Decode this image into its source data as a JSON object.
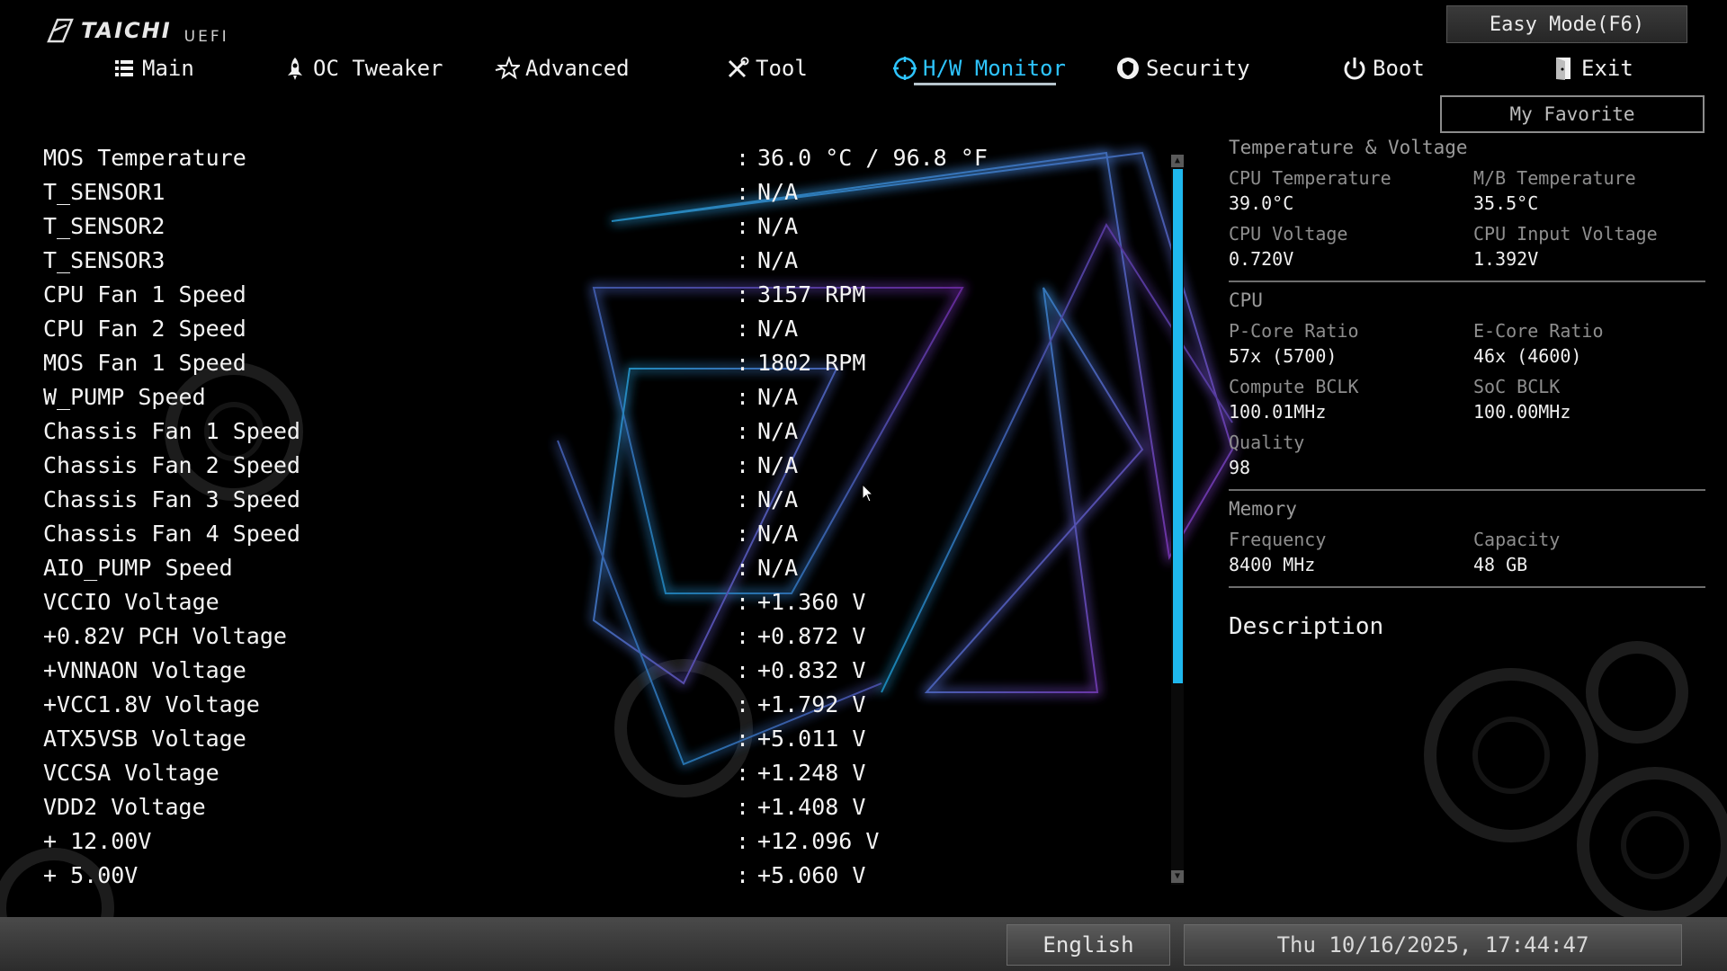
{
  "brand": {
    "name": "TAICHI",
    "sub": "UEFI"
  },
  "easy_mode_label": "Easy Mode(F6)",
  "my_favorite_label": "My Favorite",
  "nav": [
    {
      "label": "Main",
      "icon": "list-icon"
    },
    {
      "label": "OC Tweaker",
      "icon": "rocket-icon"
    },
    {
      "label": "Advanced",
      "icon": "star-icon"
    },
    {
      "label": "Tool",
      "icon": "tools-icon"
    },
    {
      "label": "H/W Monitor",
      "icon": "monitor-icon",
      "active": true
    },
    {
      "label": "Security",
      "icon": "shield-icon"
    },
    {
      "label": "Boot",
      "icon": "power-icon"
    },
    {
      "label": "Exit",
      "icon": "exit-icon"
    }
  ],
  "rows": [
    {
      "label": "MOS Temperature",
      "value": "36.0 °C /  96.8 °F"
    },
    {
      "label": "T_SENSOR1",
      "value": "N/A"
    },
    {
      "label": "T_SENSOR2",
      "value": "N/A"
    },
    {
      "label": "T_SENSOR3",
      "value": "N/A"
    },
    {
      "label": "CPU Fan 1 Speed",
      "value": "3157 RPM"
    },
    {
      "label": "CPU Fan 2 Speed",
      "value": "N/A"
    },
    {
      "label": "MOS Fan 1 Speed",
      "value": "1802 RPM"
    },
    {
      "label": "W_PUMP Speed",
      "value": "N/A"
    },
    {
      "label": "Chassis Fan 1 Speed",
      "value": "N/A"
    },
    {
      "label": "Chassis Fan 2 Speed",
      "value": "N/A"
    },
    {
      "label": "Chassis Fan 3 Speed",
      "value": "N/A"
    },
    {
      "label": "Chassis Fan 4 Speed",
      "value": "N/A"
    },
    {
      "label": "AIO_PUMP Speed",
      "value": "N/A"
    },
    {
      "label": "VCCIO Voltage",
      "value": "+1.360 V"
    },
    {
      "label": "+0.82V PCH Voltage",
      "value": "+0.872 V"
    },
    {
      "label": "+VNNAON Voltage",
      "value": "+0.832 V"
    },
    {
      "label": "+VCC1.8V Voltage",
      "value": "+1.792 V"
    },
    {
      "label": "ATX5VSB Voltage",
      "value": "+5.011 V"
    },
    {
      "label": "VCCSA Voltage",
      "value": "+1.248 V"
    },
    {
      "label": "VDD2 Voltage",
      "value": "+1.408 V"
    },
    {
      "label": "+ 12.00V",
      "value": "+12.096 V"
    },
    {
      "label": "+ 5.00V",
      "value": "+5.060 V"
    }
  ],
  "separator": ":",
  "panel": {
    "temp_voltage": {
      "title": "Temperature & Voltage",
      "cpu_temp_label": "CPU Temperature",
      "cpu_temp_value": "39.0°C",
      "mb_temp_label": "M/B Temperature",
      "mb_temp_value": "35.5°C",
      "cpu_voltage_label": "CPU Voltage",
      "cpu_voltage_value": "0.720V",
      "cpu_input_voltage_label": "CPU Input Voltage",
      "cpu_input_voltage_value": "1.392V"
    },
    "cpu": {
      "title": "CPU",
      "pcore_label": "P-Core Ratio",
      "pcore_value": "57x (5700)",
      "ecore_label": "E-Core Ratio",
      "ecore_value": "46x (4600)",
      "bclk_label": "Compute BCLK",
      "bclk_value": "100.01MHz",
      "soc_label": "SoC BCLK",
      "soc_value": "100.00MHz",
      "quality_label": "Quality",
      "quality_value": "98"
    },
    "memory": {
      "title": "Memory",
      "freq_label": "Frequency",
      "freq_value": "8400 MHz",
      "cap_label": "Capacity",
      "cap_value": "48 GB"
    },
    "description_title": "Description"
  },
  "footer": {
    "language": "English",
    "datetime": "Thu 10/16/2025, 17:44:47"
  },
  "colors": {
    "accent": "#2ec5ff",
    "scroll_thumb": "#1fb8ee",
    "glow_cyan": "#2aa8d8",
    "glow_purple": "#8a3fb8"
  }
}
